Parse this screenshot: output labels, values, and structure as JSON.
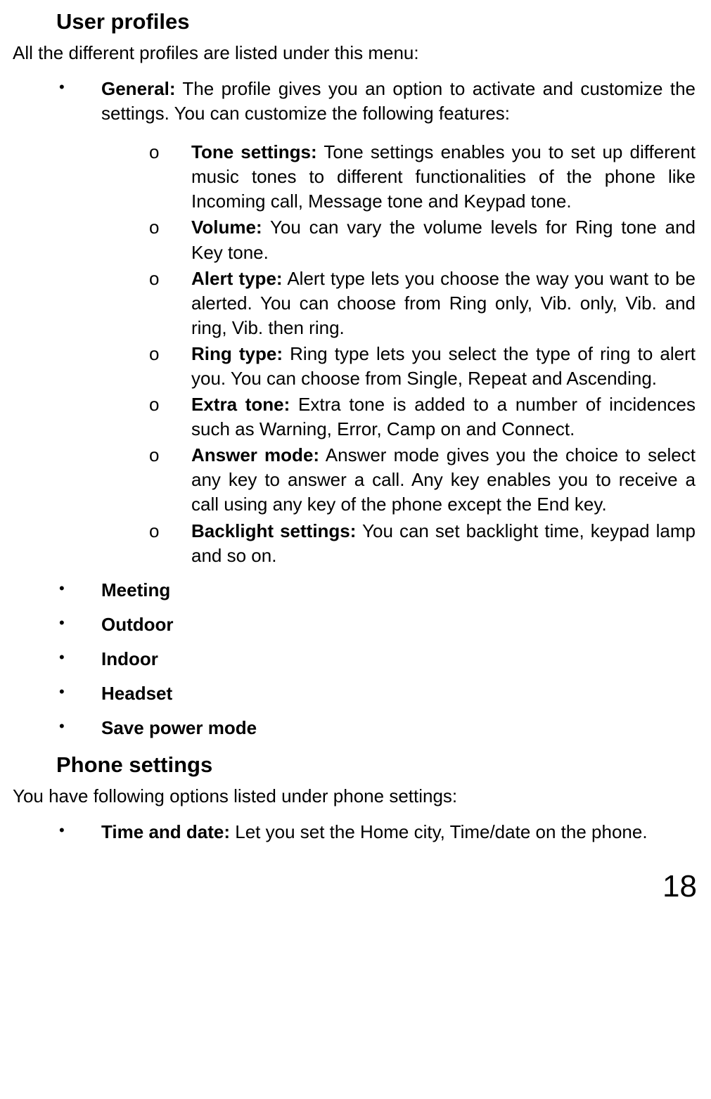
{
  "page_number": "18",
  "sections": [
    {
      "heading": "User profiles",
      "intro": "All the different profiles are listed under this menu:",
      "items": [
        {
          "label": "General:",
          "label_bold": true,
          "text": "  The profile gives you an option to activate and customize the settings. You can customize the following features:",
          "sub": [
            {
              "label": "Tone settings:",
              "text": " Tone settings enables you to set up different music tones to different functionalities of the phone like Incoming call, Message tone and Keypad tone."
            },
            {
              "label": "Volume:",
              "text": " You can vary the volume levels for Ring tone and Key tone."
            },
            {
              "label": "Alert type:",
              "text": " Alert type lets you choose the way you want to be alerted. You can choose from Ring only, Vib. only, Vib. and ring, Vib. then ring."
            },
            {
              "label": "Ring type:",
              "text": " Ring type lets you select the type of ring to alert you. You can choose from Single, Repeat and Ascending."
            },
            {
              "label": "Extra tone:",
              "text": " Extra tone is added to a number of incidences such as Warning, Error, Camp on and Connect."
            },
            {
              "label": "Answer mode:",
              "text": " Answer mode gives you the choice to select any key to answer a call. Any key enables you to receive a call using any key of the phone except the End key."
            },
            {
              "label": "Backlight settings:",
              "text": " You can set backlight time, keypad lamp and so on."
            }
          ]
        },
        {
          "label": "Meeting",
          "label_bold": true,
          "text": ""
        },
        {
          "label": "Outdoor",
          "label_bold": true,
          "text": ""
        },
        {
          "label": "Indoor",
          "label_bold": true,
          "text": ""
        },
        {
          "label": "Headset",
          "label_bold": true,
          "text": ""
        },
        {
          "label": "Save power mode",
          "label_bold": true,
          "text": ""
        }
      ]
    },
    {
      "heading": "Phone settings",
      "intro": "You have following options listed under phone settings:",
      "items": [
        {
          "label": "Time and date:",
          "label_bold": true,
          "text": " Let you set the Home city, Time/date on the phone."
        }
      ]
    }
  ]
}
